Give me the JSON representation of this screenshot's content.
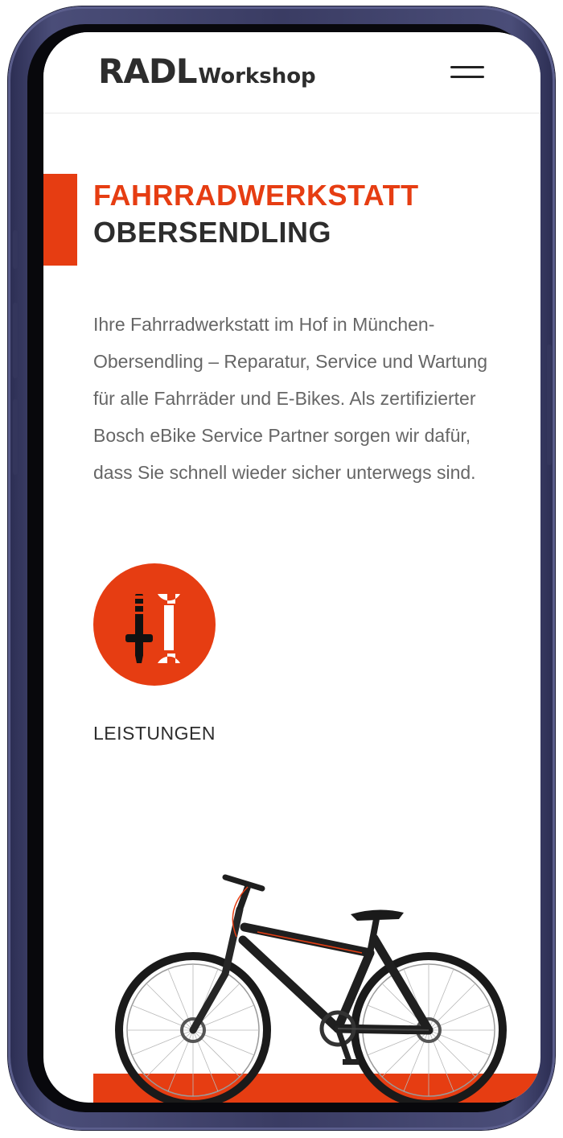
{
  "brand": {
    "logo_main": "RADL",
    "logo_sub": "Workshop",
    "accent_color": "#e63d12",
    "text_color": "#2d2d2d"
  },
  "header": {
    "menu_icon": "hamburger-menu-icon"
  },
  "hero": {
    "title_line1": "FAHRRADWERKSTATT",
    "title_line2": "OBERSENDLING",
    "description": "Ihre Fahrradwerkstatt im Hof in München-Obersendling – Reparatur, Service und Wartung für alle Fahrräder und E-Bikes. Als zertifizierter Bosch eBike Service Partner sorgen wir dafür, dass Sie schnell wieder sicher unterwegs sind."
  },
  "services": {
    "icon": "screwdriver-wrench-icon",
    "label": "LEISTUNGEN"
  },
  "footer_image": {
    "icon": "bicycle-icon"
  }
}
